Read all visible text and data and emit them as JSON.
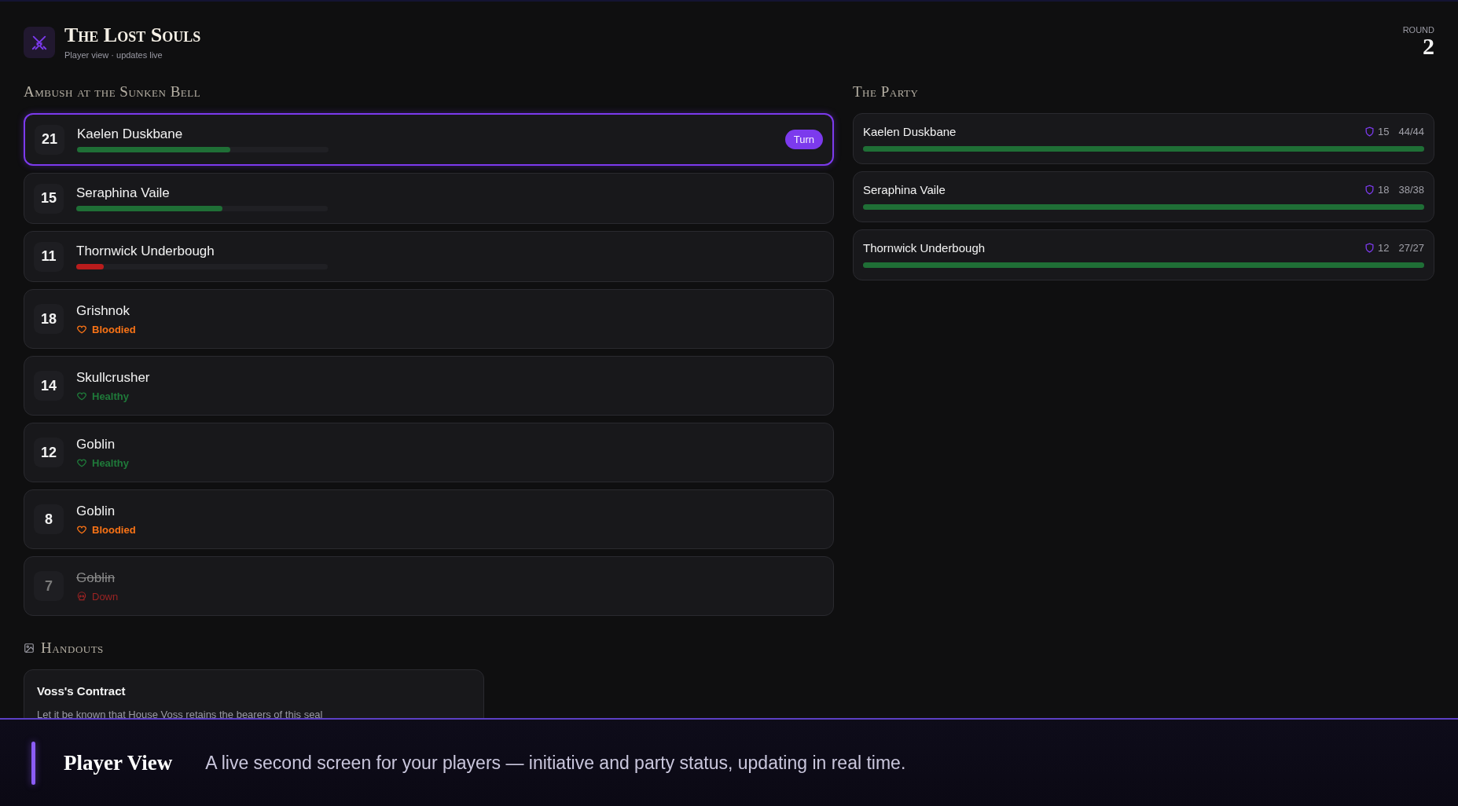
{
  "header": {
    "title": "The Lost Souls",
    "subtitle": "Player view · updates live",
    "round_label": "ROUND",
    "round": "2"
  },
  "encounter": {
    "title": "Ambush at the Sunken Bell",
    "combatants": [
      {
        "initiative": "21",
        "name": "Kaelen Duskbane",
        "kind": "hp",
        "level": 0.61,
        "selected": true,
        "badge": "Turn"
      },
      {
        "initiative": "15",
        "name": "Seraphina Vaile",
        "kind": "hp",
        "level": 0.58,
        "selected": false
      },
      {
        "initiative": "11",
        "name": "Thornwick Underbough",
        "kind": "hp",
        "level": 0.11,
        "selected": false
      },
      {
        "initiative": "18",
        "name": "Grishnok",
        "kind": "status",
        "color": "#f97316",
        "status": "Bloodied",
        "selected": false
      },
      {
        "initiative": "14",
        "name": "Skullcrusher",
        "kind": "status",
        "color": "#1f7a3a",
        "status": "Healthy",
        "selected": false
      },
      {
        "initiative": "12",
        "name": "Goblin",
        "kind": "status",
        "color": "#1f7a3a",
        "status": "Healthy",
        "selected": false
      },
      {
        "initiative": "8",
        "name": "Goblin",
        "kind": "status",
        "color": "#f97316",
        "status": "Bloodied",
        "selected": false
      },
      {
        "initiative": "7",
        "name": "Goblin",
        "kind": "down",
        "color": "#9b2424",
        "status": "Down",
        "selected": false
      }
    ]
  },
  "party": {
    "title": "The Party",
    "members": [
      {
        "name": "Kaelen Duskbane",
        "ac": "15",
        "hp": "44/44",
        "level": 1
      },
      {
        "name": "Seraphina Vaile",
        "ac": "18",
        "hp": "38/38",
        "level": 1
      },
      {
        "name": "Thornwick Underbough",
        "ac": "12",
        "hp": "27/27",
        "level": 1
      }
    ]
  },
  "handouts": {
    "title": "Handouts",
    "items": [
      {
        "title": "Voss's Contract",
        "text": "Let it be known that House Voss retains the bearers of this seal"
      }
    ]
  },
  "footer": {
    "title": "Player View",
    "text": "A live second screen for your players — initiative and party status, updating in real time."
  }
}
